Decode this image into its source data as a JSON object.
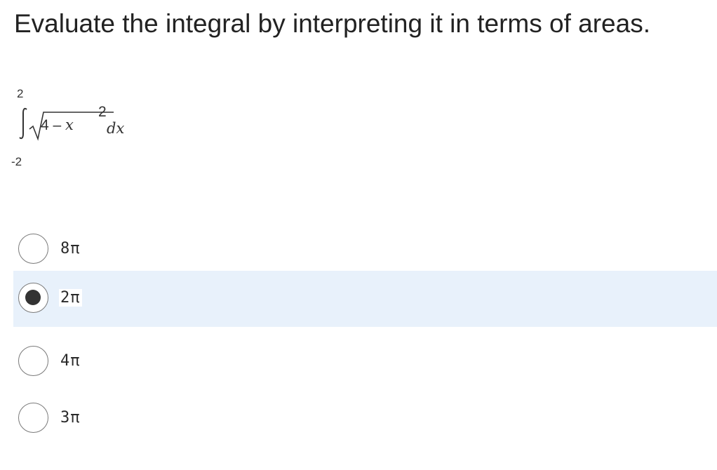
{
  "question": {
    "text": "Evaluate the integral by interpreting it in terms of areas."
  },
  "integral": {
    "upper_limit": "2",
    "lower_limit": "-2",
    "radicand_prefix": "4 – ",
    "variable": "x",
    "exponent": "2",
    "differential": "dx"
  },
  "options": [
    {
      "label": "8π",
      "selected": false
    },
    {
      "label": "2π",
      "selected": true
    },
    {
      "label": "4π",
      "selected": false
    },
    {
      "label": "3π",
      "selected": false
    }
  ],
  "colors": {
    "selected_background": "#e8f1fb",
    "radio_border": "#7a7a7a",
    "radio_dot": "#333333"
  }
}
